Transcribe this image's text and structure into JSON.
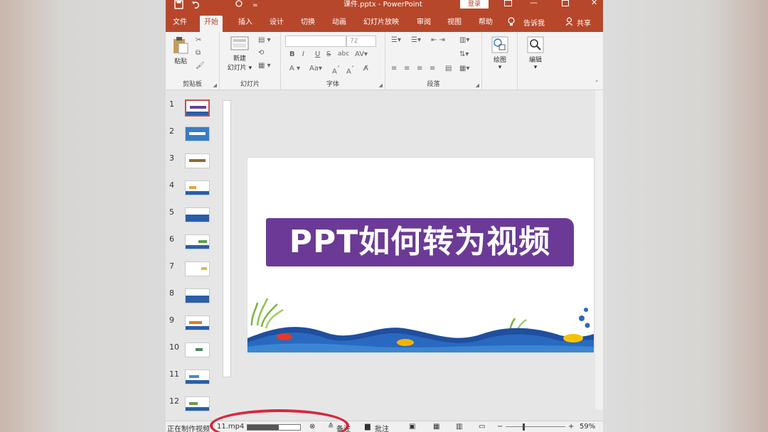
{
  "titlebar": {
    "title": "课件.pptx - PowerPoint",
    "login": "登录",
    "save_icon": "save-icon",
    "undo_icon": "undo-icon"
  },
  "tabs": [
    "文件",
    "开始",
    "插入",
    "设计",
    "切换",
    "动画",
    "幻灯片放映",
    "审阅",
    "视图",
    "帮助"
  ],
  "tell_me": "告诉我",
  "share": "共享",
  "ribbon": {
    "paste": "粘贴",
    "clipboard": "剪贴板",
    "new_slide_1": "新建",
    "new_slide_2": "幻灯片",
    "slides_group": "幻灯片",
    "font_size": "72",
    "font_group": "字体",
    "paragraph_group": "段落",
    "drawing": "绘图",
    "editing": "编辑",
    "bold": "B",
    "italic": "I",
    "underline": "U",
    "strike": "S",
    "abc": "abc"
  },
  "slides": [
    "1",
    "2",
    "3",
    "4",
    "5",
    "6",
    "7",
    "8",
    "9",
    "10",
    "11",
    "12"
  ],
  "slide": {
    "title": "PPT如何转为视频",
    "banner_color": "#6b3a96"
  },
  "status": {
    "making_video": "正在制作视频",
    "file": "11.mp4",
    "progress": 0.6,
    "notes": "备注",
    "comments": "批注",
    "zoom": "59%"
  },
  "colors": {
    "accent": "#b7472a",
    "highlight": "#d7283a"
  }
}
